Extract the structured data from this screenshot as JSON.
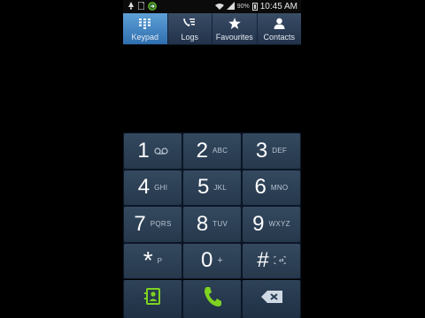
{
  "status_bar": {
    "time": "10:45 AM",
    "battery_percent": "90%",
    "icons": [
      "notification-icon",
      "sim-icon",
      "call-forward-icon",
      "wifi-icon",
      "signal-icon",
      "battery-icon"
    ]
  },
  "tabs": [
    {
      "label": "Keypad",
      "icon": "keypad-icon",
      "active": true
    },
    {
      "label": "Logs",
      "icon": "logs-icon",
      "active": false
    },
    {
      "label": "Favourites",
      "icon": "star-icon",
      "active": false
    },
    {
      "label": "Contacts",
      "icon": "contact-icon",
      "active": false
    }
  ],
  "keypad": [
    {
      "digit": "1",
      "letters": "",
      "icon": "voicemail-icon"
    },
    {
      "digit": "2",
      "letters": "ABC"
    },
    {
      "digit": "3",
      "letters": "DEF"
    },
    {
      "digit": "4",
      "letters": "GHI"
    },
    {
      "digit": "5",
      "letters": "JKL"
    },
    {
      "digit": "6",
      "letters": "MNO"
    },
    {
      "digit": "7",
      "letters": "PQRS"
    },
    {
      "digit": "8",
      "letters": "TUV"
    },
    {
      "digit": "9",
      "letters": "WXYZ"
    },
    {
      "digit": "*",
      "letters": "P"
    },
    {
      "digit": "0",
      "letters": "+"
    },
    {
      "digit": "#",
      "letters": "",
      "icon": "mute-icon"
    }
  ],
  "actions": [
    "add-contact-icon",
    "call-icon",
    "backspace-icon"
  ],
  "colors": {
    "accent": "#3f86c8",
    "call_green": "#7ed321",
    "key_bg": "#2f4256"
  }
}
